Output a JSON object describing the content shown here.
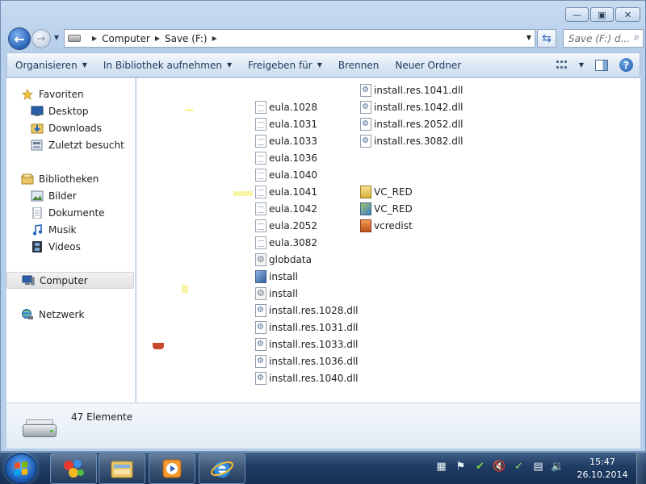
{
  "address": {
    "crumbs": [
      "Computer",
      "Save (F:)"
    ],
    "search_placeholder": "Save (F:) d..."
  },
  "toolbar": {
    "organize": "Organisieren",
    "library": "In Bibliothek aufnehmen",
    "share": "Freigeben für",
    "burn": "Brennen",
    "new_folder": "Neuer Ordner"
  },
  "nav": {
    "favorites": "Favoriten",
    "desktop": "Desktop",
    "downloads": "Downloads",
    "recent": "Zuletzt besucht",
    "libraries": "Bibliotheken",
    "pictures": "Bilder",
    "documents": "Dokumente",
    "music": "Musik",
    "videos": "Videos",
    "computer": "Computer",
    "network": "Netzwerk"
  },
  "files": {
    "col1": [
      {
        "name": "eula.1028",
        "icon": "document"
      },
      {
        "name": "eula.1031",
        "icon": "document"
      },
      {
        "name": "eula.1033",
        "icon": "document"
      },
      {
        "name": "eula.1036",
        "icon": "document"
      },
      {
        "name": "eula.1040",
        "icon": "document"
      },
      {
        "name": "eula.1041",
        "icon": "document"
      },
      {
        "name": "eula.1042",
        "icon": "document"
      },
      {
        "name": "eula.2052",
        "icon": "document"
      },
      {
        "name": "eula.3082",
        "icon": "document"
      },
      {
        "name": "globdata",
        "icon": "settings"
      },
      {
        "name": "install",
        "icon": "setup"
      },
      {
        "name": "install",
        "icon": "settings"
      },
      {
        "name": "install.res.1028.dll",
        "icon": "dll"
      },
      {
        "name": "install.res.1031.dll",
        "icon": "dll"
      },
      {
        "name": "install.res.1033.dll",
        "icon": "dll"
      },
      {
        "name": "install.res.1036.dll",
        "icon": "dll"
      },
      {
        "name": "install.res.1040.dll",
        "icon": "dll"
      }
    ],
    "col2": [
      {
        "name": "install.res.1041.dll",
        "icon": "dll"
      },
      {
        "name": "install.res.1042.dll",
        "icon": "dll"
      },
      {
        "name": "install.res.2052.dll",
        "icon": "dll"
      },
      {
        "name": "install.res.3082.dll",
        "icon": "dll"
      },
      {
        "name": "VC_RED",
        "icon": "vcred"
      },
      {
        "name": "VC_RED",
        "icon": "msi"
      },
      {
        "name": "vcredist",
        "icon": "cab"
      }
    ]
  },
  "details": {
    "count": "47 Elemente"
  },
  "taskbar": {
    "time": "15:47",
    "date": "26.10.2014"
  }
}
